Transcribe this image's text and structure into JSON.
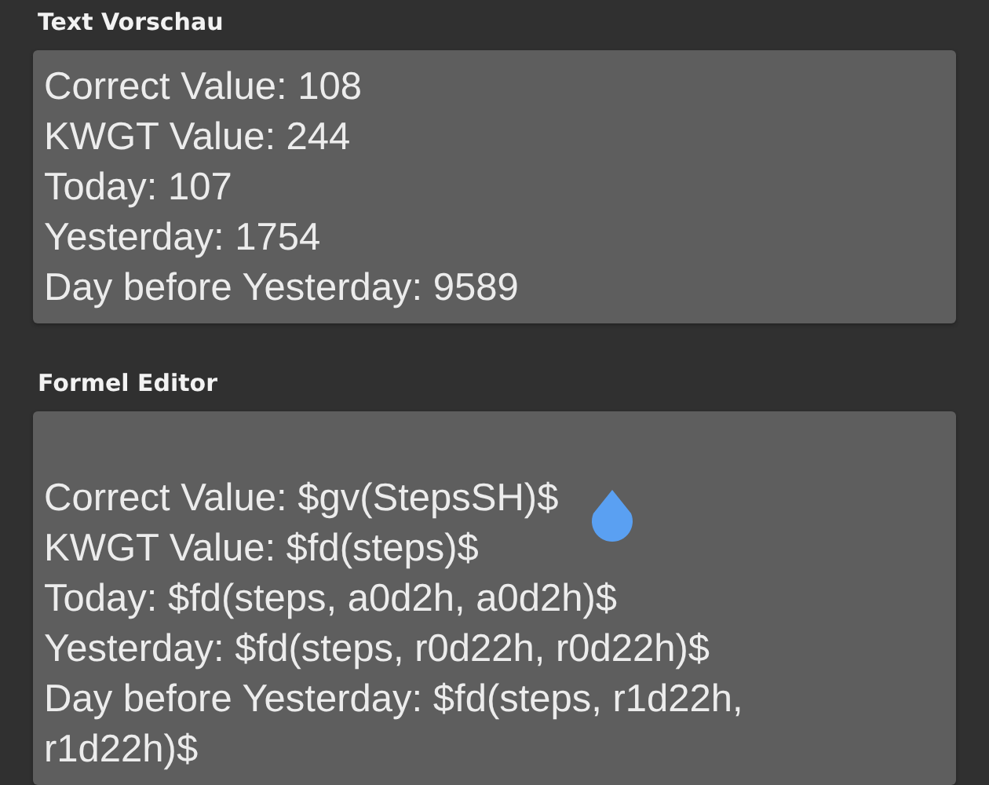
{
  "sections": [
    {
      "title": "Text Vorschau",
      "kind": "preview",
      "lines": [
        "Correct Value: 108",
        "KWGT Value: 244",
        "Today: 107",
        "Yesterday: 1754",
        "Day before Yesterday: 9589"
      ]
    },
    {
      "title": "Formel Editor",
      "kind": "editor",
      "leading_blank_line": true,
      "lines": [
        "Correct Value: $gv(StepsSH)$",
        "KWGT Value: $fd(steps)$",
        "Today: $fd(steps, a0d2h, a0d2h)$",
        "Yesterday: $fd(steps, r0d22h, r0d22h)$",
        "Day before Yesterday: $fd(steps, r1d22h,",
        "r1d22h)$"
      ],
      "selection_handle": true
    }
  ]
}
